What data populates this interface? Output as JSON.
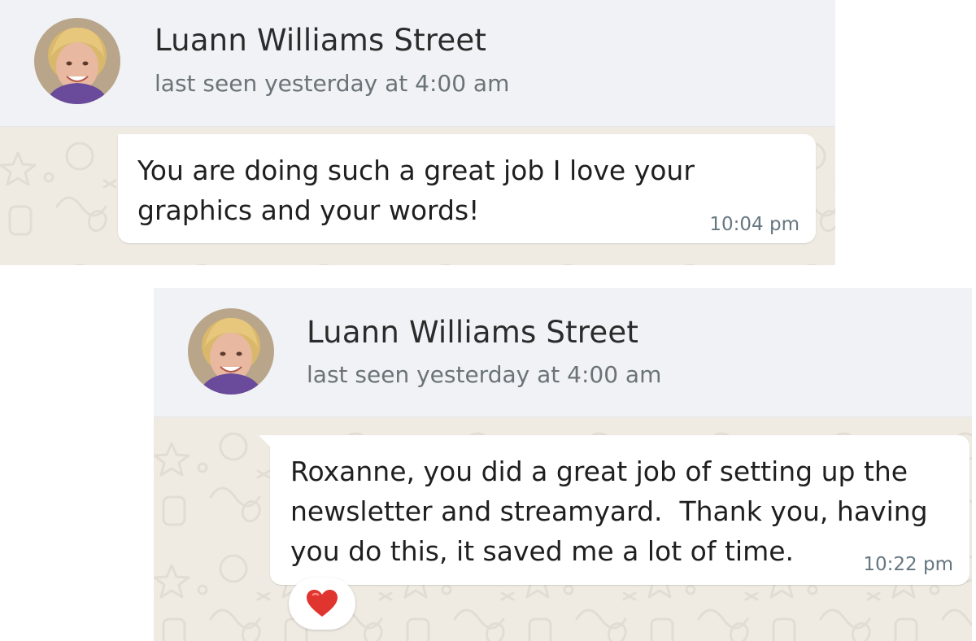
{
  "screenshots": [
    {
      "contact": {
        "name": "Luann Williams Street",
        "status": "last seen yesterday at 4:00 am"
      },
      "message": {
        "text": "You are doing such a great job I love your\ngraphics and your words!",
        "time": "10:04 pm"
      }
    },
    {
      "contact": {
        "name": "Luann Williams Street",
        "status": "last seen yesterday at 4:00 am"
      },
      "message": {
        "text": "Roxanne, you did a great job of setting up the\nnewsletter and streamyard.  Thank you, having\nyou do this, it saved me a lot of time.",
        "time": "10:22 pm",
        "reaction": "red-heart-icon"
      }
    }
  ],
  "colors": {
    "header_bg": "#f0f2f5",
    "chat_bg": "#efeae2",
    "bubble_bg": "#ffffff",
    "timestamp": "#667781",
    "heart": "#e0342f"
  }
}
